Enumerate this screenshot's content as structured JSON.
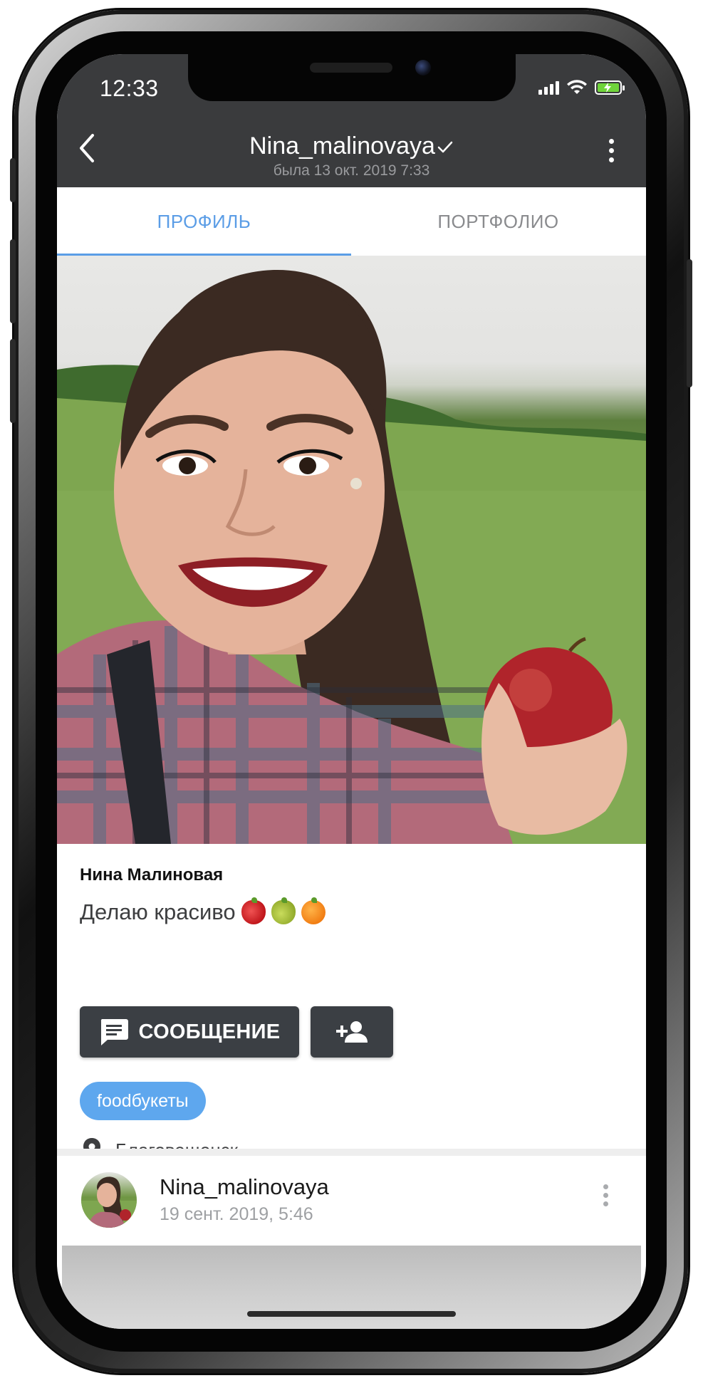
{
  "status_bar": {
    "time": "12:33"
  },
  "header": {
    "username": "Nina_malinovaya",
    "last_seen": "была 13 окт. 2019 7:33",
    "verified_icon": "check-icon",
    "back_icon": "chevron-left-icon",
    "menu_icon": "more-vertical-icon"
  },
  "tabs": [
    {
      "label": "ПРОФИЛЬ",
      "active": true
    },
    {
      "label": "ПОРТФОЛИО",
      "active": false
    }
  ],
  "profile": {
    "full_name": "Нина Малиновая",
    "bio_text": "Делаю красиво",
    "bio_emojis": [
      "strawberry",
      "pear",
      "tangerine"
    ],
    "message_button_label": "СООБЩЕНИЕ",
    "message_icon": "chat-icon",
    "add_friend_icon": "person-add-icon",
    "tag": "foodбукеты",
    "location_icon": "location-pin-icon",
    "location": "Благовещенск"
  },
  "post": {
    "author": "Nina_malinovaya",
    "date": "19 сент. 2019, 5:46",
    "menu_icon": "more-vertical-icon"
  },
  "colors": {
    "header_bg": "#3a3b3d",
    "accent_blue": "#5b9de6",
    "tag_blue": "#5ea7ee",
    "button_dark": "#3b3f44"
  }
}
